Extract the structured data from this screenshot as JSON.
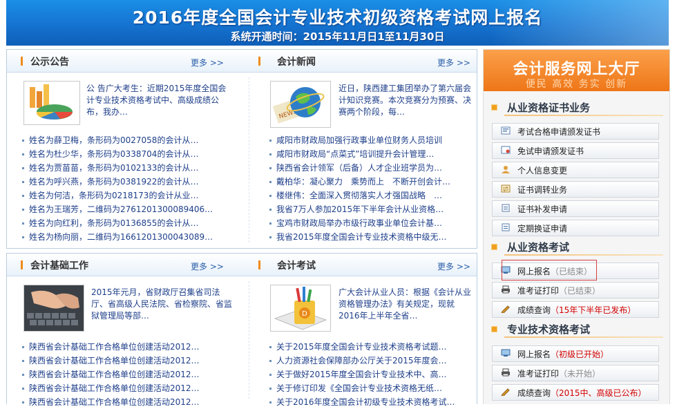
{
  "banner": {
    "title": "2016年度全国会计专业技术初级资格考试网上报名",
    "subtitle": "系统开通时间：2015年11月日1至11月30日"
  },
  "sections": {
    "announcement": {
      "title": "公示公告",
      "more": "更多 >>",
      "intro": "公 告广大考生：近期2015年度全国会计专业技术资格考试中、高级成绩公布，我办…",
      "items": [
        "姓名为薛卫梅，条形码为0027058的会计从…",
        "姓名为杜少华，条形码为0338704的会计从…",
        "姓名为贾苗苗，条形码为0102133的会计从…",
        "姓名为呼兴燕，条形码为0381922的会计从…",
        "姓名为何洁，条形码为0218173的会计从业…",
        "姓名为王瑞芳，二维码为2761201300089406…",
        "姓名为向红利，条形码为0136855的会计从…",
        "姓名为杨向丽，二维码为1661201300043089…"
      ]
    },
    "news": {
      "title": "会计新闻",
      "more": "更多 >>",
      "intro": "近日，陕西建工集团举办了第六届会计知识竞赛。本次竞赛分为预赛、决赛两个阶段，每…",
      "items": [
        "咸阳市财政局加强行政事业单位财务人员培训",
        "咸阳市财政局“点菜式”培训提升会计管理…",
        "陕西省会计领军（后备）人才企业班学员为…",
        "戴柏华：凝心聚力　乘势而上　不断开创会计…",
        "楼继伟：全面深入贯彻落实人才强国战略　…",
        "我省7万人参加2015年下半年会计从业资格…",
        "宝鸡市财政局举办市级行政事业单位会计基…",
        "我省2015年度全国会计专业技术资格中级无…"
      ]
    },
    "basics": {
      "title": "会计基础工作",
      "more": "更多 >>",
      "intro": "2015年元月，省财政厅召集省司法厅、省高级人民法院、省检察院、省监狱管理局等部…",
      "items": [
        "陕西省会计基础工作合格单位创建活动2012…",
        "陕西省会计基础工作合格单位创建活动2012…",
        "陕西省会计基础工作合格单位创建活动2012…",
        "陕西省会计基础工作合格单位创建活动2012…",
        "陕西省会计基础工作合格单位创建活动2012…"
      ]
    },
    "exam": {
      "title": "会计考试",
      "more": "更多 >>",
      "intro": "广大会计从业人员：根据《会计从业资格管理办法》有关规定，现就2016年上半年全省…",
      "items": [
        "关于2015年度全国会计专业技术资格考试题…",
        "人力资源社会保障部办公厅关于2015年度会…",
        "关于做好2015年度全国会计专业技术中、高…",
        "关于修订印发《全国会计专业技术资格无纸…",
        "关于2016年度全国会计初级专业技术资格考试…"
      ]
    }
  },
  "sidebar": {
    "hall_title": "会计服务网上大厅",
    "hall_slogan": "便民 高效 务实 创新",
    "categories": [
      {
        "title": "从业资格证书业务",
        "items": [
          {
            "label": "考试合格申请颁发证书",
            "status": "",
            "tone": ""
          },
          {
            "label": "免试申请颁发证书",
            "status": "",
            "tone": ""
          },
          {
            "label": "个人信息变更",
            "status": "",
            "tone": ""
          },
          {
            "label": "证书调转业务",
            "status": "",
            "tone": ""
          },
          {
            "label": "证书补发申请",
            "status": "",
            "tone": ""
          },
          {
            "label": "定期换证申请",
            "status": "",
            "tone": ""
          }
        ]
      },
      {
        "title": "从业资格考试",
        "items": [
          {
            "label": "网上报名",
            "status": "（已结束）",
            "tone": "gray"
          },
          {
            "label": "准考证打印",
            "status": "（已结束）",
            "tone": "gray"
          },
          {
            "label": "成绩查询",
            "status": "（15年下半年已发布）",
            "tone": "red"
          }
        ]
      },
      {
        "title": "专业技术资格考试",
        "items": [
          {
            "label": "网上报名",
            "status": "（初级已开始）",
            "tone": "red"
          },
          {
            "label": "准考证打印",
            "status": "（未开始）",
            "tone": "gray"
          },
          {
            "label": "成绩查询",
            "status": "（2015中、高级已公布）",
            "tone": "red"
          }
        ]
      }
    ]
  },
  "colors": {
    "banner_blue": "#1573d0",
    "accent_orange": "#ee7618",
    "link_blue": "#1e3f8a",
    "status_red": "#d10000"
  }
}
